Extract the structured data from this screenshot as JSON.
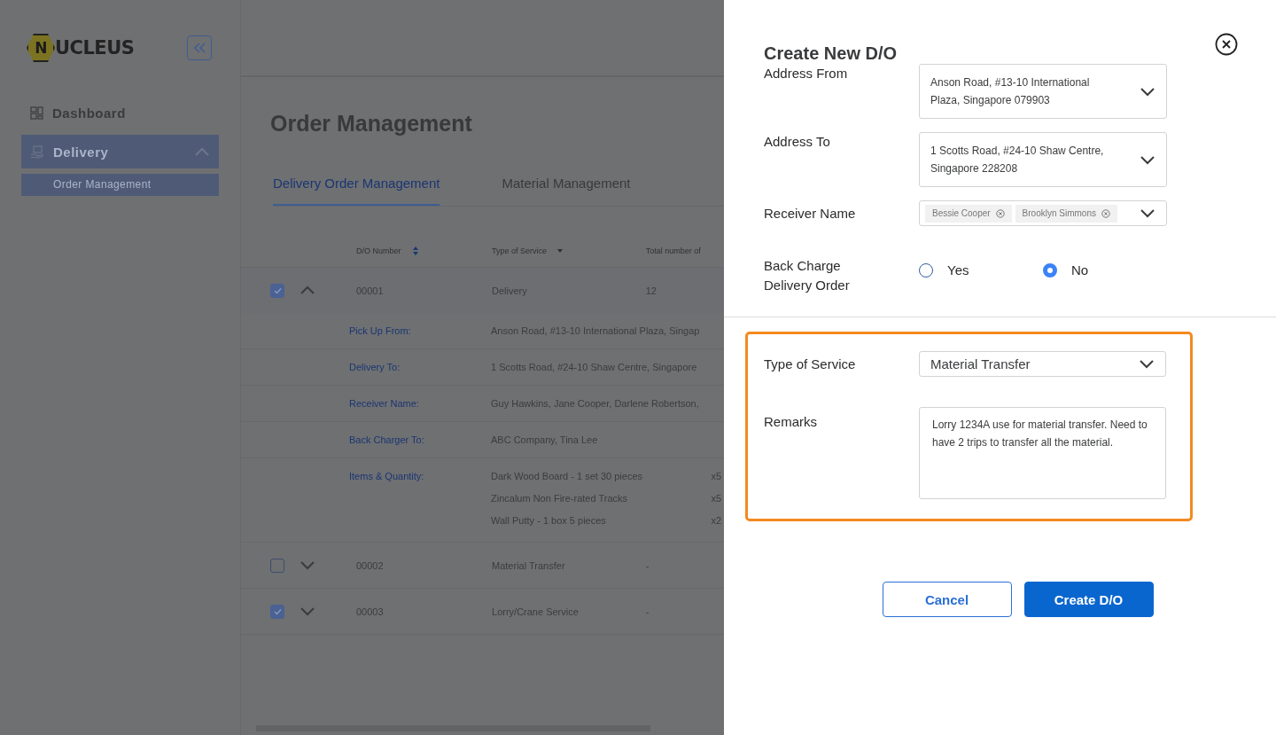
{
  "sidebar": {
    "logo": {
      "initial": "N",
      "rest": "UCLEUS"
    },
    "items": [
      {
        "label": "Dashboard",
        "selected": false
      },
      {
        "label": "Delivery",
        "selected": true,
        "expanded": true,
        "children": [
          {
            "label": "Order Management",
            "selected": true
          }
        ]
      }
    ]
  },
  "page": {
    "title": "Order Management",
    "tabs": [
      {
        "label": "Delivery Order Management",
        "selected": true
      },
      {
        "label": "Material Management",
        "selected": false
      }
    ],
    "table": {
      "columns": [
        {
          "label": "D/O Number",
          "kind": "sortable"
        },
        {
          "label": "Type of Service",
          "kind": "filter"
        },
        {
          "label": "Total number of",
          "kind": "plain"
        }
      ],
      "rows": [
        {
          "number": "00001",
          "service": "Delivery",
          "total": "12",
          "checked": true,
          "expanded": true,
          "details": [
            {
              "label": "Pick Up From:",
              "value": "Anson Road, #13-10 International Plaza, Singap"
            },
            {
              "label": "Delivery To:",
              "value": "1 Scotts Road, #24-10 Shaw Centre, Singapore"
            },
            {
              "label": "Receiver Name:",
              "value": "Guy Hawkins, Jane Cooper, Darlene Robertson,"
            },
            {
              "label": "Back Charger To:",
              "value": "ABC Company, Tina Lee"
            }
          ],
          "items_label": "Items & Quantity:",
          "items": [
            {
              "name": "Dark Wood Board - 1 set 30 pieces",
              "qty": "x5"
            },
            {
              "name": "Zincalum Non Fire-rated Tracks",
              "qty": "x5"
            },
            {
              "name": "Wall Putty - 1 box 5 pieces",
              "qty": "x2"
            }
          ]
        },
        {
          "number": "00002",
          "service": "Material Transfer",
          "total": "-",
          "checked": false,
          "expanded": false
        },
        {
          "number": "00003",
          "service": "Lorry/Crane Service",
          "total": "-",
          "checked": true,
          "expanded": false
        }
      ]
    }
  },
  "modal": {
    "title": "Create New D/O",
    "sections": [
      {
        "fields": [
          {
            "kind": "select",
            "label": "Address From",
            "value": "Anson Road, #13-10 International Plaza, Singapore 079903"
          },
          {
            "kind": "select",
            "label": "Address To",
            "value": "1 Scotts Road, #24-10 Shaw Centre, Singapore 228208"
          },
          {
            "kind": "tags",
            "label": "Receiver Name",
            "tags": [
              "Bessie Cooper",
              "Brooklyn Simmons"
            ]
          },
          {
            "kind": "radio",
            "label": "Back Charge Delivery Order",
            "options": [
              {
                "label": "Yes",
                "selected": false
              },
              {
                "label": "No",
                "selected": true
              }
            ]
          }
        ]
      },
      {
        "highlighted": true,
        "fields": [
          {
            "kind": "select",
            "label": "Type of Service",
            "value": "Material Transfer"
          },
          {
            "kind": "textarea",
            "label": "Remarks",
            "value": "Lorry 1234A use for material transfer. Need to have 2 trips to transfer all the material."
          }
        ]
      }
    ],
    "buttons": [
      {
        "label": "Cancel",
        "kind": "secondary"
      },
      {
        "label": "Create D/O",
        "kind": "primary"
      }
    ]
  }
}
